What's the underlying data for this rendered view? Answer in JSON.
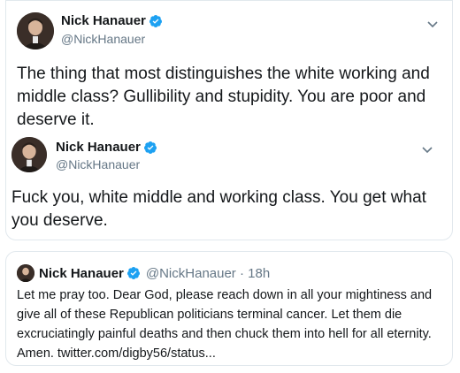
{
  "tweet1": {
    "display_name": "Nick Hanauer",
    "handle": "@NickHanauer",
    "text": "The thing that most distinguishes the white working and middle class?  Gullibility and stupidity. You are poor and deserve it."
  },
  "tweet2": {
    "display_name": "Nick Hanauer",
    "handle": "@NickHanauer",
    "text": "Fuck you, white middle and working class. You get what you deserve."
  },
  "quoted": {
    "display_name": "Nick Hanauer",
    "handle_time": "@NickHanauer · 18h",
    "text": "Let me pray too.  Dear God, please reach down in all your mightiness and give all of these Republican politicians terminal cancer. Let them die excruciatingly painful deaths and then chuck them into hell for all eternity.  Amen. twitter.com/digby56/status..."
  },
  "icons": {
    "verified": "verified-badge-icon",
    "menu": "chevron-down-icon"
  },
  "colors": {
    "verified_blue": "#1da1f2",
    "secondary_text": "#657786",
    "border": "#e1e8ed"
  }
}
